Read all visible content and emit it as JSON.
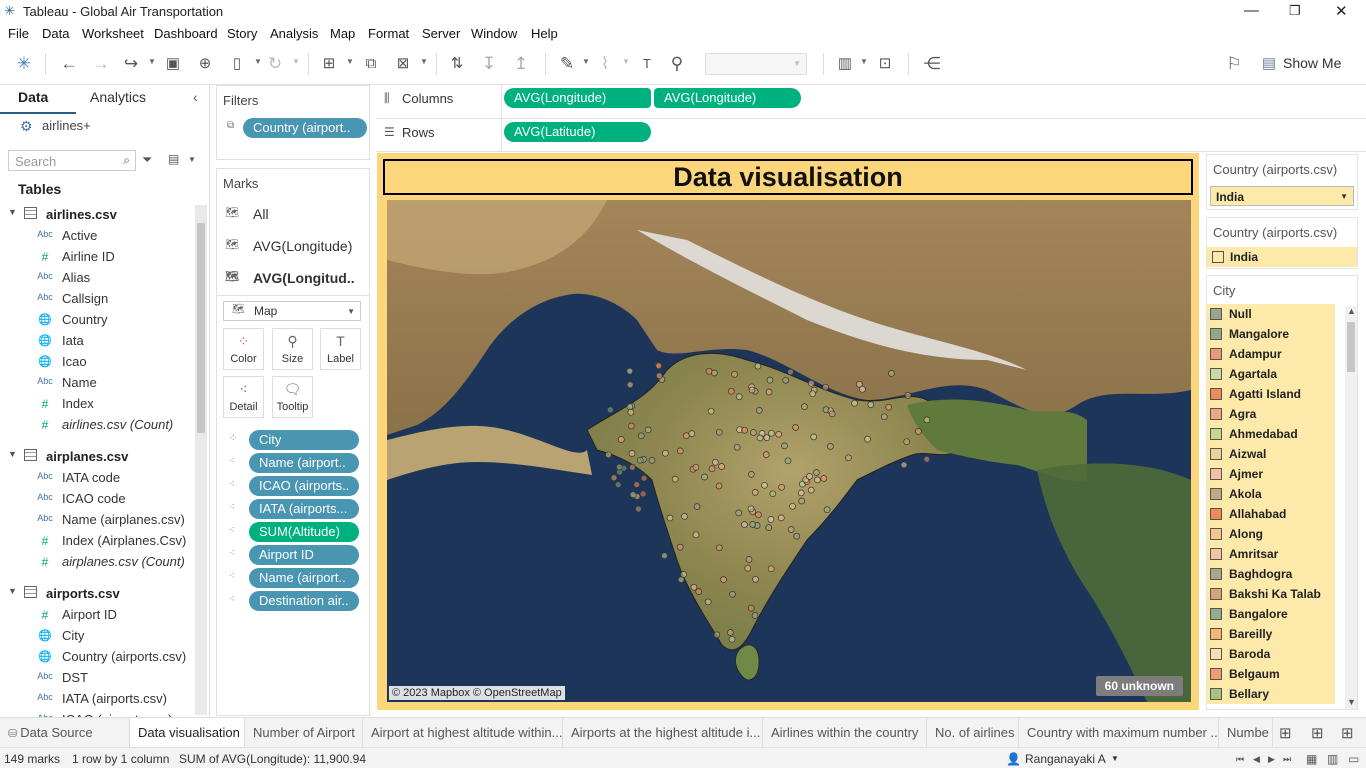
{
  "window": {
    "title": "Tableau - Global Air Transportation"
  },
  "menu": [
    "File",
    "Data",
    "Worksheet",
    "Dashboard",
    "Story",
    "Analysis",
    "Map",
    "Format",
    "Server",
    "Window",
    "Help"
  ],
  "toolbar": {
    "show_me": "Show Me"
  },
  "left_pane": {
    "tabs": [
      "Data",
      "Analytics"
    ],
    "datasource": "airlines+",
    "search_placeholder": "Search",
    "tables_header": "Tables",
    "tables": [
      {
        "name": "airlines.csv",
        "fields": [
          {
            "type": "Abc",
            "name": "Active"
          },
          {
            "type": "#",
            "name": "Airline ID"
          },
          {
            "type": "Abc",
            "name": "Alias"
          },
          {
            "type": "Abc",
            "name": "Callsign"
          },
          {
            "type": "globe",
            "name": "Country"
          },
          {
            "type": "globe",
            "name": "Iata"
          },
          {
            "type": "globe",
            "name": "Icao"
          },
          {
            "type": "Abc",
            "name": "Name"
          },
          {
            "type": "#",
            "name": "Index"
          },
          {
            "type": "#",
            "name": "airlines.csv (Count)"
          }
        ]
      },
      {
        "name": "airplanes.csv",
        "fields": [
          {
            "type": "Abc",
            "name": "IATA code"
          },
          {
            "type": "Abc",
            "name": "ICAO code"
          },
          {
            "type": "Abc",
            "name": "Name (airplanes.csv)"
          },
          {
            "type": "#",
            "name": "Index (Airplanes.Csv)"
          },
          {
            "type": "#",
            "name": "airplanes.csv (Count)"
          }
        ]
      },
      {
        "name": "airports.csv",
        "fields": [
          {
            "type": "#",
            "name": "Airport ID"
          },
          {
            "type": "globe",
            "name": "City"
          },
          {
            "type": "globe",
            "name": "Country (airports.csv)"
          },
          {
            "type": "Abc",
            "name": "DST"
          },
          {
            "type": "Abc",
            "name": "IATA (airports.csv)"
          },
          {
            "type": "Abc",
            "name": "ICAO (airports.csv)"
          }
        ]
      }
    ]
  },
  "filters": {
    "title": "Filters",
    "items": [
      "Country (airport.."
    ]
  },
  "marks": {
    "title": "Marks",
    "layers": [
      "All",
      "AVG(Longitude)",
      "AVG(Longitud.."
    ],
    "mark_type": "Map",
    "buttons": [
      "Color",
      "Size",
      "Label",
      "Detail",
      "Tooltip"
    ],
    "pills": [
      {
        "label": "City",
        "color": "blue",
        "icon": "color"
      },
      {
        "label": "Name (airport..",
        "color": "blue",
        "icon": "detail"
      },
      {
        "label": "ICAO (airports..",
        "color": "blue",
        "icon": "detail"
      },
      {
        "label": "IATA (airports...",
        "color": "blue",
        "icon": "detail"
      },
      {
        "label": "SUM(Altitude)",
        "color": "green",
        "icon": "detail"
      },
      {
        "label": "Airport ID",
        "color": "blue",
        "icon": "detail"
      },
      {
        "label": "Name (airport..",
        "color": "blue",
        "icon": "detail"
      },
      {
        "label": "Destination air..",
        "color": "blue",
        "icon": "detail"
      }
    ]
  },
  "shelves": {
    "columns_label": "Columns",
    "columns": [
      "AVG(Longitude)",
      "AVG(Longitude)"
    ],
    "rows_label": "Rows",
    "rows": [
      "AVG(Latitude)"
    ]
  },
  "dashboard": {
    "title": "Data visualisation",
    "attribution": "© 2023 Mapbox © OpenStreetMap",
    "unknown_badge": "60 unknown"
  },
  "right_pane": {
    "filter_card_title": "Country (airports.csv)",
    "filter_value": "India",
    "legend_card_title": "Country (airports.csv)",
    "legend_value": "India",
    "city_title": "City",
    "cities": [
      {
        "name": "Null",
        "color": "#9aa68c"
      },
      {
        "name": "Mangalore",
        "color": "#8fa88a"
      },
      {
        "name": "Adampur",
        "color": "#e99878"
      },
      {
        "name": "Agartala",
        "color": "#c9dba2"
      },
      {
        "name": "Agatti Island",
        "color": "#ee8b5a"
      },
      {
        "name": "Agra",
        "color": "#f0a784"
      },
      {
        "name": "Ahmedabad",
        "color": "#c7d88e"
      },
      {
        "name": "Aizwal",
        "color": "#e5d59a"
      },
      {
        "name": "Ajmer",
        "color": "#f4bfa8"
      },
      {
        "name": "Akola",
        "color": "#c1a886"
      },
      {
        "name": "Allahabad",
        "color": "#f18a57"
      },
      {
        "name": "Along",
        "color": "#f7c68c"
      },
      {
        "name": "Amritsar",
        "color": "#f3c5a5"
      },
      {
        "name": "Baghdogra",
        "color": "#a8a788"
      },
      {
        "name": "Bakshi Ka Talab",
        "color": "#d2a47a"
      },
      {
        "name": "Bangalore",
        "color": "#93ad8c"
      },
      {
        "name": "Bareilly",
        "color": "#f7b772"
      },
      {
        "name": "Baroda",
        "color": "#f3dfb8"
      },
      {
        "name": "Belgaum",
        "color": "#ef9c72"
      },
      {
        "name": "Bellary",
        "color": "#a9c37c"
      }
    ]
  },
  "bottom_tabs": [
    "Data Source",
    "Data visualisation",
    "Number of Airport",
    "Airport at highest altitude within...",
    "Airports at the highest altitude i...",
    "Airlines within the country",
    "No. of airlines",
    "Country with maximum number ...",
    "Numbe"
  ],
  "status": {
    "marks": "149 marks",
    "rows": "1 row by 1 column",
    "sum": "SUM of AVG(Longitude): 11,900.94",
    "user": "Ranganayaki A"
  }
}
